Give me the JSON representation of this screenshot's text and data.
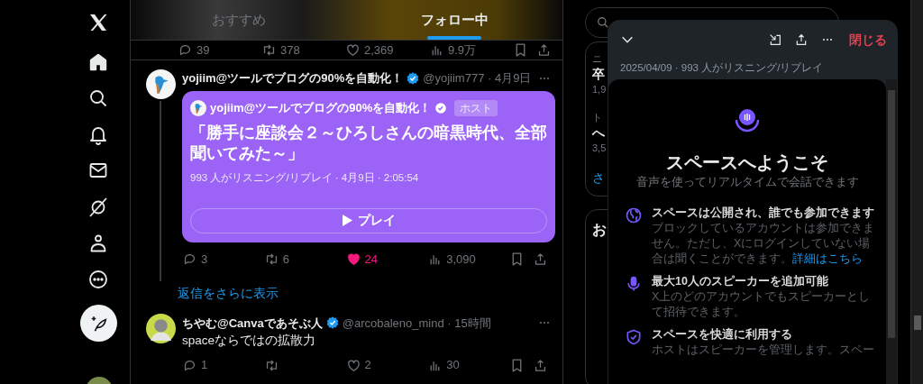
{
  "sidebar": {
    "items": [
      {
        "kind": "home",
        "selected": true
      },
      {
        "kind": "search",
        "selected": false
      },
      {
        "kind": "bell",
        "selected": false
      },
      {
        "kind": "mail",
        "selected": false
      },
      {
        "kind": "slash",
        "selected": false
      },
      {
        "kind": "person",
        "selected": false
      },
      {
        "kind": "more",
        "selected": false
      }
    ]
  },
  "tabs": [
    {
      "label": "おすすめ",
      "selected": false
    },
    {
      "label": "フォロー中",
      "selected": true
    }
  ],
  "previous_actions": {
    "replies": "39",
    "reposts": "378",
    "likes": "2,369",
    "liked": false,
    "views": "9.9万"
  },
  "tweets": [
    {
      "name": "yojiim@ツールでブログの90%を自動化！",
      "verified": true,
      "meta": "@yojiim777 · 4月9日",
      "space_card": {
        "host_name": "yojiim@ツールでブログの90%を自動化！",
        "host_badge": "ホスト",
        "title": "「勝手に座談会２～ひろしさんの暗黒時代、全部聞いてみた～」",
        "stats": "993 人がリスニング/リプレイ · 4月9日 · 2:05:54",
        "play": "プレイ"
      },
      "actions": {
        "replies": "3",
        "reposts": "6",
        "likes": "24",
        "liked": true,
        "views": "3,090"
      }
    },
    {
      "name": "ちやむ@Canvaであそぶ人",
      "verified": true,
      "meta": "@arcobaleno_mind · 15時間",
      "text": "spaceならではの拡散力",
      "actions": {
        "replies": "1",
        "likes": "2",
        "liked": false,
        "views": "30"
      }
    }
  ],
  "show_more_replies": "返信をさらに表示",
  "right_column": {
    "trends": [
      {
        "lines": [
          "ニ",
          "卒",
          "1,9"
        ]
      },
      {
        "lines": [
          "ト",
          "へ",
          "3,5"
        ]
      }
    ],
    "show_more": "さ",
    "follow_title": "お"
  },
  "space_modal": {
    "info": "2025/04/09 · 993 人がリスニング/リプレイ",
    "close": "閉じる",
    "title": "スペースへようこそ",
    "subtitle": "音声を使ってリアルタイムで会話できます",
    "features": [
      {
        "kind": "globe",
        "title": "スペースは公開され、誰でも参加できます",
        "body": "ブロックしているアカウントは参加できません。ただし、Xにログインしていない場合は聞くことができます。",
        "link": "詳細はこちら"
      },
      {
        "kind": "mic",
        "title": "最大10人のスピーカーを追加可能",
        "body": "X上のどのアカウントでもスピーカーとして招待できます。"
      },
      {
        "kind": "shield",
        "title": "スペースを快適に利用する",
        "body": "ホストはスピーカーを管理します。スペー"
      }
    ]
  }
}
